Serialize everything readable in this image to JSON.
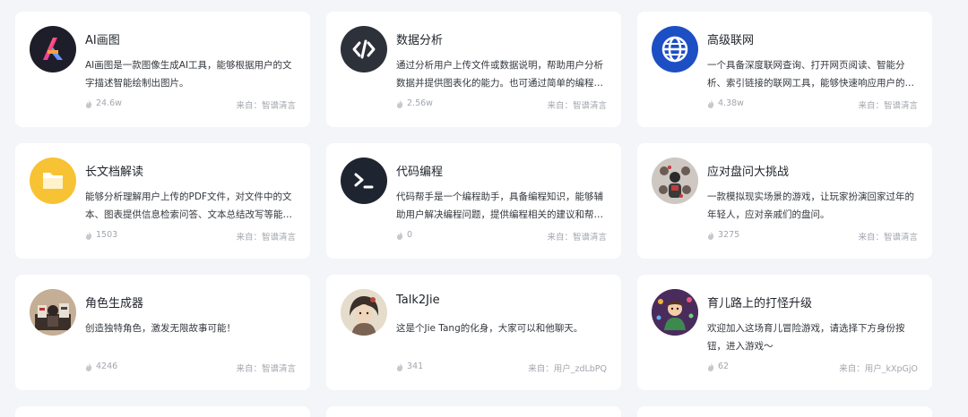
{
  "cards": [
    {
      "name": "AI画图",
      "desc": "AI画图是一款图像生成AI工具，能够根据用户的文字描述智能绘制出图片。",
      "count": "24.6w",
      "source": "来自：智谱清言",
      "icon": "ai-logo-icon"
    },
    {
      "name": "数据分析",
      "desc": "通过分析用户上传文件或数据说明，帮助用户分析数据并提供图表化的能力。也可通过简单的编程完成文件处理工作。",
      "count": "2.56w",
      "source": "来自：智谱清言",
      "icon": "code-brackets-icon"
    },
    {
      "name": "高级联网",
      "desc": "一个具备深度联网查询、打开网页阅读、智能分析、索引链接的联网工具，能够快速响应用户的问题。",
      "count": "4.38w",
      "source": "来自：智谱清言",
      "icon": "globe-icon"
    },
    {
      "name": "长文档解读",
      "desc": "能够分析理解用户上传的PDF文件，对文件中的文本、图表提供信息检索问答、文本总结改写等能力。",
      "count": "1503",
      "source": "来自：智谱清言",
      "icon": "folder-icon"
    },
    {
      "name": "代码编程",
      "desc": "代码帮手是一个编程助手，具备编程知识，能够辅助用户解决编程问题，提供编程相关的建议和帮助。",
      "count": "0",
      "source": "来自：智谱清言",
      "icon": "terminal-icon"
    },
    {
      "name": "应对盘问大挑战",
      "desc": "一款模拟现实场景的游戏，让玩家扮演回家过年的年轻人，应对亲戚们的盘问。",
      "count": "3275",
      "source": "来自：智谱清言",
      "icon": "family-avatar-icon"
    },
    {
      "name": "角色生成器",
      "desc": "创造独特角色，激发无限故事可能！",
      "count": "4246",
      "source": "来自：智谱清言",
      "icon": "character-avatar-icon"
    },
    {
      "name": "Talk2Jie",
      "desc": "这是个Jie Tang的化身，大家可以和他聊天。",
      "count": "341",
      "source": "来自：用户_zdLbPQ",
      "icon": "portrait-avatar-icon"
    },
    {
      "name": "育儿路上的打怪升级",
      "desc": "欢迎加入这场育儿冒险游戏，请选择下方身份按钮，进入游戏～",
      "count": "62",
      "source": "来自：用户_kXpGjO",
      "icon": "parenting-avatar-icon"
    }
  ],
  "colors": {
    "page_bg": "#f4f5f9",
    "card_bg": "#ffffff",
    "ai_logo_bg": "#1e1e2a",
    "data_icon_bg": "#2d3139",
    "globe_bg": "#1d4fc4",
    "folder_bg": "#f7c234",
    "terminal_bg": "#1f2530"
  }
}
